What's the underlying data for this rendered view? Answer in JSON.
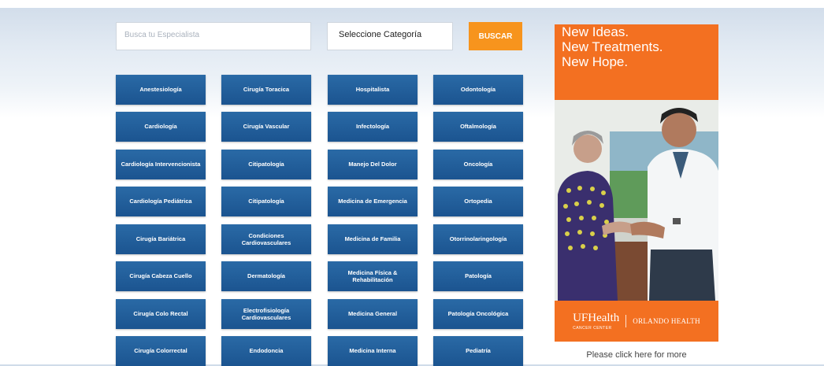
{
  "search": {
    "placeholder": "Busca tu Especialista",
    "category_value": "Seleccione Categoría",
    "button_label": "BUSCAR"
  },
  "specialties": {
    "col1": [
      "Anestesiología",
      "Cardiología",
      "Cardiología Intervencionista",
      "Cardiología Pediátrica",
      "Cirugía Bariátrica",
      "Cirugía Cabeza Cuello",
      "Cirugía Colo Rectal",
      "Cirugía Colorrectal"
    ],
    "col2": [
      "Cirugía Toracica",
      "Cirugía Vascular",
      "Citipatología",
      "Citipatología",
      "Condiciones Cardiovasculares",
      "Dermatología",
      "Electrofisiología Cardiovasculares",
      "Endodoncia"
    ],
    "col3": [
      "Hospitalista",
      "Infectología",
      "Manejo Del Dolor",
      "Medicina de Emergencia",
      "Medicina de Familia",
      "Medicina Física & Rehabilitación",
      "Medicina General",
      "Medicina Interna"
    ],
    "col4": [
      "Odontología",
      "Oftalmología",
      "Oncología",
      "Ortopedia",
      "Otorrinolaringología",
      "Patología",
      "Patología Oncológica",
      "Pediatría"
    ]
  },
  "ad": {
    "headline_1": "New Ideas.",
    "headline_2": "New Treatments.",
    "headline_3": "New Hope.",
    "logo_main": "UFHealth",
    "logo_sub": "CANCER CENTER",
    "logo_right": "ORLANDO HEALTH",
    "caption": "Please click here for more",
    "accent": "#f37021"
  },
  "colors": {
    "button_blue": "#1f5b96",
    "search_orange": "#f7941d"
  }
}
